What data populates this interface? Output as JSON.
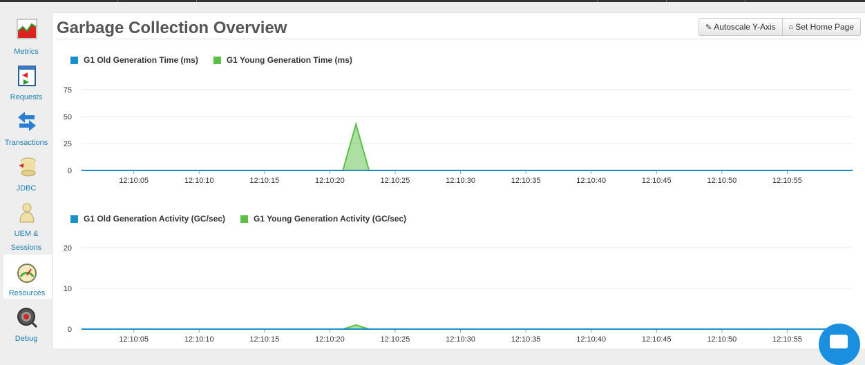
{
  "sidebar": {
    "items": [
      {
        "label": "Metrics",
        "icon": "metrics-chart-icon",
        "active": false
      },
      {
        "label": "Requests",
        "icon": "requests-icon",
        "active": false
      },
      {
        "label": "Transactions",
        "icon": "transactions-arrows-icon",
        "active": false
      },
      {
        "label": "JDBC",
        "icon": "database-icon",
        "active": false
      },
      {
        "label": "UEM &",
        "label2": "Sessions",
        "icon": "user-icon",
        "active": false
      },
      {
        "label": "Resources",
        "icon": "gauge-icon",
        "active": true
      },
      {
        "label": "Debug",
        "icon": "debug-icon",
        "active": false
      }
    ]
  },
  "header": {
    "title": "Garbage Collection Overview",
    "autoscale_label": "Autoscale Y-Axis",
    "home_label": "Set Home Page"
  },
  "colors": {
    "old_gen": "#1a8fc9",
    "young_gen": "#5cbf47",
    "link": "#1a7db5"
  },
  "chart_data": [
    {
      "type": "area",
      "series": [
        {
          "name": "G1 Old Generation Time (ms)",
          "x": [
            "12:10:01",
            "12:10:21",
            "12:10:22",
            "12:10:23",
            "12:10:60"
          ],
          "values": [
            0,
            0,
            0,
            0,
            0
          ]
        },
        {
          "name": "G1 Young Generation Time (ms)",
          "x": [
            "12:10:01",
            "12:10:21",
            "12:10:22",
            "12:10:23",
            "12:10:60"
          ],
          "values": [
            0,
            0,
            43,
            0,
            0
          ]
        }
      ],
      "xticks": [
        "12:10:05",
        "12:10:10",
        "12:10:15",
        "12:10:20",
        "12:10:25",
        "12:10:30",
        "12:10:35",
        "12:10:40",
        "12:10:45",
        "12:10:50",
        "12:10:55"
      ],
      "yticks": [
        "0",
        "25",
        "50",
        "75"
      ],
      "ylim": [
        0,
        75
      ],
      "grid": true,
      "legend": "top-left"
    },
    {
      "type": "area",
      "series": [
        {
          "name": "G1 Old Generation Activity (GC/sec)",
          "x": [
            "12:10:01",
            "12:10:21",
            "12:10:22",
            "12:10:23",
            "12:10:60"
          ],
          "values": [
            0,
            0,
            0,
            0,
            0
          ]
        },
        {
          "name": "G1 Young Generation Activity (GC/sec)",
          "x": [
            "12:10:01",
            "12:10:21",
            "12:10:22",
            "12:10:23",
            "12:10:60"
          ],
          "values": [
            0,
            0,
            1,
            0,
            0
          ]
        }
      ],
      "xticks": [
        "12:10:05",
        "12:10:10",
        "12:10:15",
        "12:10:20",
        "12:10:25",
        "12:10:30",
        "12:10:35",
        "12:10:40",
        "12:10:45",
        "12:10:50",
        "12:10:55"
      ],
      "yticks": [
        "0",
        "10",
        "20"
      ],
      "ylim": [
        0,
        20
      ],
      "grid": true,
      "legend": "top-left"
    }
  ]
}
